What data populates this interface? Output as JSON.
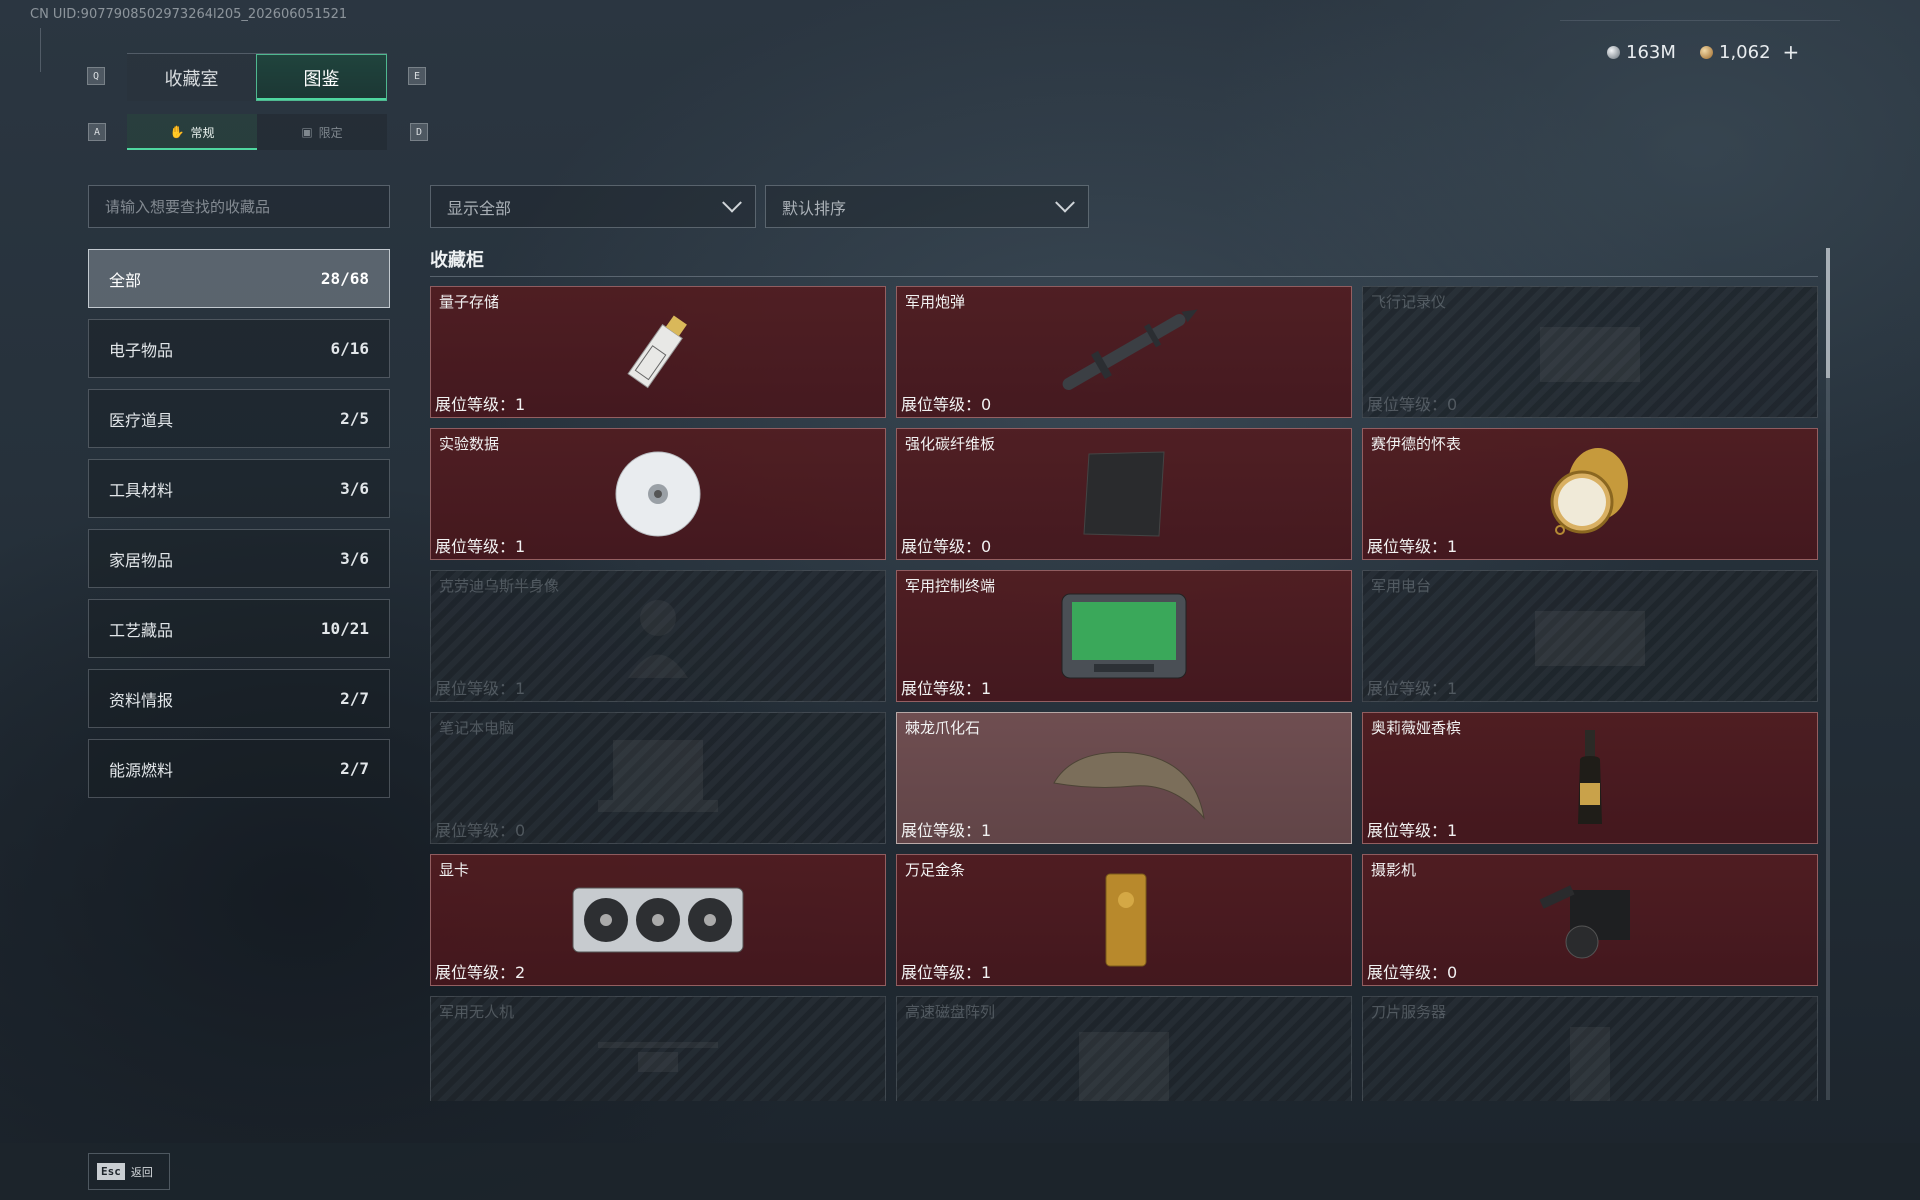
{
  "uid": "CN UID:9077908502973264l205_202606051521",
  "currency": {
    "silver": "163M",
    "gold": "1,062",
    "plus_icon": "plus-icon"
  },
  "keys": {
    "q": "Q",
    "e": "E",
    "a": "A",
    "d": "D",
    "esc": "Esc"
  },
  "main_tabs": [
    {
      "label": "收藏室",
      "active": false
    },
    {
      "label": "图鉴",
      "active": true
    }
  ],
  "sub_tabs": [
    {
      "label": "常规",
      "icon": "hand-icon",
      "active": true
    },
    {
      "label": "限定",
      "icon": "image-icon",
      "active": false
    }
  ],
  "search": {
    "placeholder": "请输入想要查找的收藏品"
  },
  "categories": [
    {
      "label": "全部",
      "count": "28/68",
      "active": true
    },
    {
      "label": "电子物品",
      "count": "6/16"
    },
    {
      "label": "医疗道具",
      "count": "2/5"
    },
    {
      "label": "工具材料",
      "count": "3/6"
    },
    {
      "label": "家居物品",
      "count": "3/6"
    },
    {
      "label": "工艺藏品",
      "count": "10/21"
    },
    {
      "label": "资料情报",
      "count": "2/7"
    },
    {
      "label": "能源燃料",
      "count": "2/7"
    }
  ],
  "filters": {
    "show": "显示全部",
    "sort": "默认排序"
  },
  "section_title": "收藏柜",
  "level_prefix": "展位等级：",
  "items": [
    {
      "name": "量子存储",
      "level": "1",
      "state": "owned",
      "art": "usb-drive"
    },
    {
      "name": "军用炮弹",
      "level": "0",
      "state": "owned",
      "art": "missile"
    },
    {
      "name": "飞行记录仪",
      "level": "0",
      "state": "locked",
      "art": "recorder"
    },
    {
      "name": "实验数据",
      "level": "1",
      "state": "owned",
      "art": "disc"
    },
    {
      "name": "强化碳纤维板",
      "level": "0",
      "state": "owned",
      "art": "carbon-plate"
    },
    {
      "name": "赛伊德的怀表",
      "level": "1",
      "state": "owned",
      "art": "pocket-watch"
    },
    {
      "name": "克劳迪乌斯半身像",
      "level": "1",
      "state": "locked",
      "art": "bust"
    },
    {
      "name": "军用控制终端",
      "level": "1",
      "state": "owned",
      "art": "terminal"
    },
    {
      "name": "军用电台",
      "level": "1",
      "state": "locked",
      "art": "radio"
    },
    {
      "name": "笔记本电脑",
      "level": "0",
      "state": "locked",
      "art": "laptop"
    },
    {
      "name": "棘龙爪化石",
      "level": "1",
      "state": "selected",
      "art": "claw-fossil"
    },
    {
      "name": "奥莉薇娅香槟",
      "level": "1",
      "state": "owned",
      "art": "champagne"
    },
    {
      "name": "显卡",
      "level": "2",
      "state": "owned",
      "art": "graphics-card"
    },
    {
      "name": "万足金条",
      "level": "1",
      "state": "owned",
      "art": "gold-bar"
    },
    {
      "name": "摄影机",
      "level": "0",
      "state": "owned",
      "art": "camera"
    },
    {
      "name": "军用无人机",
      "level": "",
      "state": "locked",
      "art": "drone"
    },
    {
      "name": "高速磁盘阵列",
      "level": "",
      "state": "locked",
      "art": "disk-array"
    },
    {
      "name": "刀片服务器",
      "level": "",
      "state": "locked",
      "art": "blade-server"
    }
  ],
  "back_label": "返回"
}
